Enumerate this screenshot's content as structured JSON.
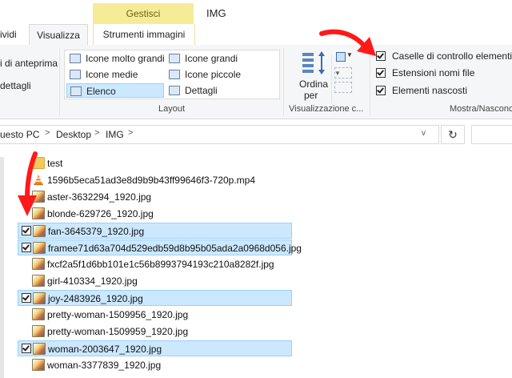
{
  "window": {
    "title": "IMG",
    "context_tab": "Gestisci"
  },
  "tabs": {
    "condividi": "ividi",
    "visualizza": "Visualizza",
    "strumenti": "Strumenti immagini"
  },
  "ribbon": {
    "panes": {
      "anteprima": "i di anteprima",
      "dettagli": "dettagli"
    },
    "layout": {
      "label": "Layout",
      "items": [
        "Icone molto grandi",
        "Icone grandi",
        "Icone medie",
        "Icone piccole",
        "Elenco",
        "Dettagli"
      ],
      "selected": "Elenco"
    },
    "view": {
      "sort_line1": "Ordina",
      "sort_line2": "per",
      "label": "Visualizzazione c..."
    },
    "show_hide": {
      "label": "Mostra/Nasconc",
      "checkboxes": [
        {
          "label": "Caselle di controllo elementi",
          "checked": true
        },
        {
          "label": "Estensioni nomi file",
          "checked": true
        },
        {
          "label": "Elementi nascosti",
          "checked": true
        }
      ]
    }
  },
  "address": {
    "crumbs": [
      "uesto PC",
      "Desktop",
      "IMG"
    ],
    "sep": ">",
    "dropdown": "v",
    "refresh": "↻"
  },
  "files": [
    {
      "name": "test",
      "type": "folder",
      "selected": false
    },
    {
      "name": "1596b5eca51ad3e8d9b9b43ff99646f3-720p.mp4",
      "type": "video",
      "selected": false
    },
    {
      "name": "aster-3632294_1920.jpg",
      "type": "image",
      "selected": false
    },
    {
      "name": "blonde-629726_1920.jpg",
      "type": "image",
      "selected": false
    },
    {
      "name": "fan-3645379_1920.jpg",
      "type": "image",
      "selected": true
    },
    {
      "name": "framee71d63a704d529edb59d8b95b05ada2a0968d056.jpg",
      "type": "image",
      "selected": true
    },
    {
      "name": "fxcf2a5f1d6bb101e1c56b8993794193c210a8282f.jpg",
      "type": "image",
      "selected": false
    },
    {
      "name": "girl-410334_1920.jpg",
      "type": "image",
      "selected": false
    },
    {
      "name": "joy-2483926_1920.jpg",
      "type": "image",
      "selected": true
    },
    {
      "name": "pretty-woman-1509956_1920.jpg",
      "type": "image",
      "selected": false
    },
    {
      "name": "pretty-woman-1509959_1920.jpg",
      "type": "image",
      "selected": false
    },
    {
      "name": "woman-2003647_1920.jpg",
      "type": "image",
      "selected": true
    },
    {
      "name": "woman-3377839_1920.jpg",
      "type": "image",
      "selected": false
    }
  ],
  "colors": {
    "selection": "#cce8ff",
    "selection_border": "#99d1ff",
    "context_tab": "#f6ec98",
    "annotation_arrow": "#ff1a1a"
  }
}
